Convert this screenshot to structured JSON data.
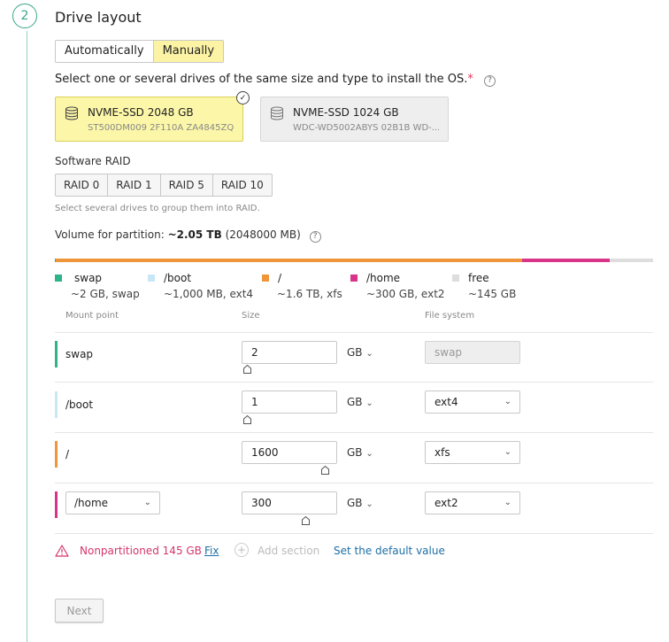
{
  "step": {
    "number": "2",
    "title": "Drive layout"
  },
  "layout_mode": {
    "options": [
      "Automatically",
      "Manually"
    ],
    "selected": "Manually"
  },
  "drives": {
    "instruction": "Select one or several drives of the same size and type to install the OS.",
    "required_mark": "*",
    "help_icon": "question-icon",
    "items": [
      {
        "name": "NVME-SSD 2048 GB",
        "serial": "ST500DM009 2F110A ZA4845ZQ",
        "selected": true
      },
      {
        "name": "NVME-SSD 1024 GB",
        "serial": "WDC-WD5002ABYS 02B1B WD-...",
        "selected": false
      }
    ]
  },
  "raid": {
    "label": "Software RAID",
    "options": [
      "RAID 0",
      "RAID 1",
      "RAID 5",
      "RAID 10"
    ],
    "hint": "Select several drives to group them into RAID."
  },
  "volume": {
    "label": "Volume for partition:",
    "size_bold": "~2.05 TB",
    "size_mb": "(2048000 MB)"
  },
  "usage": [
    {
      "name": "swap",
      "desc": "~2 GB, swap",
      "color": "#2fb38a",
      "fraction": 0.001
    },
    {
      "name": "/boot",
      "desc": "~1,000 MB, ext4",
      "color": "#c9e6f7",
      "fraction": 0.0005
    },
    {
      "name": "/",
      "desc": "~1.6 TB, xfs",
      "color": "#f0963a",
      "fraction": 0.78
    },
    {
      "name": "/home",
      "desc": "~300 GB, ext2",
      "color": "#d8358a",
      "fraction": 0.146
    },
    {
      "name": "free",
      "desc": "~145 GB",
      "color": "#dddddd",
      "fraction": 0.0725
    }
  ],
  "table": {
    "headers": {
      "mount": "Mount point",
      "size": "Size",
      "fs": "File system"
    },
    "rows": [
      {
        "mount": "swap",
        "size": "2",
        "unit": "GB",
        "fs": "swap",
        "fs_disabled": true,
        "slider": 0.0
      },
      {
        "mount": "/boot",
        "size": "1",
        "unit": "GB",
        "fs": "ext4",
        "fs_disabled": false,
        "slider": 0.0
      },
      {
        "mount": "/",
        "size": "1600",
        "unit": "GB",
        "fs": "xfs",
        "fs_disabled": false,
        "slider": 0.8
      },
      {
        "mount": "/home",
        "size": "300",
        "unit": "GB",
        "fs": "ext2",
        "fs_disabled": false,
        "slider": 0.6
      }
    ]
  },
  "warning": {
    "text": "Nonpartitioned 145 GB",
    "fix": "Fix",
    "add_section": "Add section",
    "set_default": "Set the default value"
  },
  "next_button": "Next"
}
